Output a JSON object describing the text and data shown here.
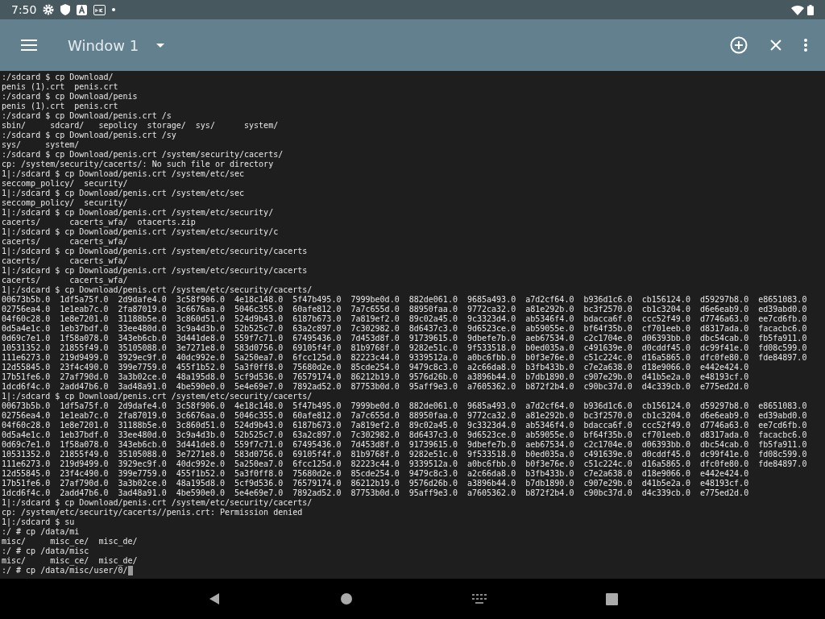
{
  "status_bar": {
    "time": "7:50"
  },
  "toolbar": {
    "title": "Window 1"
  },
  "terminal": {
    "cursor": true,
    "lines": [
      ":/sdcard $ cp Download/",
      "penis (1).crt  penis.crt",
      ":/sdcard $ cp Download/penis",
      "penis (1).crt  penis.crt",
      ":/sdcard $ cp Download/penis.crt /s",
      "sbin/     sdcard/   sepolicy  storage/  sys/      system/",
      ":/sdcard $ cp Download/penis.crt /sy",
      "sys/     system/",
      ":/sdcard $ cp Download/penis.crt /system/security/cacerts/",
      "cp: /system/security/cacerts/: No such file or directory",
      "1|:/sdcard $ cp Download/penis.crt /system/etc/sec",
      "seccomp_policy/  security/",
      "1|:/sdcard $ cp Download/penis.crt /system/etc/sec",
      "seccomp_policy/  security/",
      "1|:/sdcard $ cp Download/penis.crt /system/etc/security/",
      "cacerts/      cacerts_wfa/  otacerts.zip",
      "1|:/sdcard $ cp Download/penis.crt /system/etc/security/c",
      "cacerts/      cacerts_wfa/",
      "1|:/sdcard $ cp Download/penis.crt /system/etc/security/cacerts",
      "cacerts/      cacerts_wfa/",
      "1|:/sdcard $ cp Download/penis.crt /system/etc/security/cacerts",
      "cacerts/      cacerts_wfa/",
      "1|:/sdcard $ cp Download/penis.crt /system/etc/security/cacerts/",
      "00673b5b.0  1df5a75f.0  2d9dafe4.0  3c58f906.0  4e18c148.0  5f47b495.0  7999be0d.0  882de061.0  9685a493.0  a7d2cf64.0  b936d1c6.0  cb156124.0  d59297b8.0  e8651083.0",
      "02756ea4.0  1e1eab7c.0  2fa87019.0  3c6676aa.0  5046c355.0  60afe812.0  7a7c655d.0  88950faa.0  9772ca32.0  a81e292b.0  bc3f2570.0  cb1c3204.0  d6e6eab9.0  ed39abd0.0",
      "04f60c28.0  1e8e7201.0  31188b5e.0  3c860d51.0  524d9b43.0  6187b673.0  7a819ef2.0  89c02a45.0  9c3323d4.0  ab5346f4.0  bdacca6f.0  ccc52f49.0  d7746a63.0  ee7cd6fb.0",
      "0d5a4e1c.0  1eb37bdf.0  33ee480d.0  3c9a4d3b.0  52b525c7.0  63a2c897.0  7c302982.0  8d6437c3.0  9d6523ce.0  ab59055e.0  bf64f35b.0  cf701eeb.0  d8317ada.0  facacbc6.0",
      "0d69c7e1.0  1f58a078.0  343eb6cb.0  3d441de8.0  559f7c71.0  67495436.0  7d453d8f.0  91739615.0  9dbefe7b.0  aeb67534.0  c2c1704e.0  d06393bb.0  dbc54cab.0  fb5fa911.0",
      "10531352.0  21855f49.0  35105088.0  3e7271e8.0  583d0756.0  69105f4f.0  81b9768f.0  9282e51c.0  9f533518.0  b0ed035a.0  c491639e.0  d0cddf45.0  dc99f41e.0  fd08c599.0",
      "111e6273.0  219d9499.0  3929ec9f.0  40dc992e.0  5a250ea7.0  6fcc125d.0  82223c44.0  9339512a.0  a0bc6fbb.0  b0f3e76e.0  c51c224c.0  d16a5865.0  dfc0fe80.0  fde84897.0",
      "12d55845.0  23f4c490.0  399e7759.0  455f1b52.0  5a3f0ff8.0  75680d2e.0  85cde254.0  9479c8c3.0  a2c66da8.0  b3fb433b.0  c7e2a638.0  d18e9066.0  e442e424.0",
      "17b51fe6.0  27af790d.0  3a3b02ce.0  48a195d8.0  5cf9d536.0  76579174.0  86212b19.0  9576d26b.0  a3896b44.0  b7db1890.0  c907e29b.0  d41b5e2a.0  e48193cf.0",
      "1dcd6f4c.0  2add47b6.0  3ad48a91.0  4be590e0.0  5e4e69e7.0  7892ad52.0  87753b0d.0  95aff9e3.0  a7605362.0  b872f2b4.0  c90bc37d.0  d4c339cb.0  e775ed2d.0",
      "1|:/sdcard $ cp Download/penis.crt /system/etc/security/cacerts/",
      "00673b5b.0  1df5a75f.0  2d9dafe4.0  3c58f906.0  4e18c148.0  5f47b495.0  7999be0d.0  882de061.0  9685a493.0  a7d2cf64.0  b936d1c6.0  cb156124.0  d59297b8.0  e8651083.0",
      "02756ea4.0  1e1eab7c.0  2fa87019.0  3c6676aa.0  5046c355.0  60afe812.0  7a7c655d.0  88950faa.0  9772ca32.0  a81e292b.0  bc3f2570.0  cb1c3204.0  d6e6eab9.0  ed39abd0.0",
      "04f60c28.0  1e8e7201.0  31188b5e.0  3c860d51.0  524d9b43.0  6187b673.0  7a819ef2.0  89c02a45.0  9c3323d4.0  ab5346f4.0  bdacca6f.0  ccc52f49.0  d7746a63.0  ee7cd6fb.0",
      "0d5a4e1c.0  1eb37bdf.0  33ee480d.0  3c9a4d3b.0  52b525c7.0  63a2c897.0  7c302982.0  8d6437c3.0  9d6523ce.0  ab59055e.0  bf64f35b.0  cf701eeb.0  d8317ada.0  facacbc6.0",
      "0d69c7e1.0  1f58a078.0  343eb6cb.0  3d441de8.0  559f7c71.0  67495436.0  7d453d8f.0  91739615.0  9dbefe7b.0  aeb67534.0  c2c1704e.0  d06393bb.0  dbc54cab.0  fb5fa911.0",
      "10531352.0  21855f49.0  35105088.0  3e7271e8.0  583d0756.0  69105f4f.0  81b9768f.0  9282e51c.0  9f533518.0  b0ed035a.0  c491639e.0  d0cddf45.0  dc99f41e.0  fd08c599.0",
      "111e6273.0  219d9499.0  3929ec9f.0  40dc992e.0  5a250ea7.0  6fcc125d.0  82223c44.0  9339512a.0  a0bc6fbb.0  b0f3e76e.0  c51c224c.0  d16a5865.0  dfc0fe80.0  fde84897.0",
      "12d55845.0  23f4c490.0  399e7759.0  455f1b52.0  5a3f0ff8.0  75680d2e.0  85cde254.0  9479c8c3.0  a2c66da8.0  b3fb433b.0  c7e2a638.0  d18e9066.0  e442e424.0",
      "17b51fe6.0  27af790d.0  3a3b02ce.0  48a195d8.0  5cf9d536.0  76579174.0  86212b19.0  9576d26b.0  a3896b44.0  b7db1890.0  c907e29b.0  d41b5e2a.0  e48193cf.0",
      "1dcd6f4c.0  2add47b6.0  3ad48a91.0  4be590e0.0  5e4e69e7.0  7892ad52.0  87753b0d.0  95aff9e3.0  a7605362.0  b872f2b4.0  c90bc37d.0  d4c339cb.0  e775ed2d.0",
      "1|:/sdcard $ cp Download/penis.crt /system/etc/security/cacerts/",
      "cp: /system/etc/security/cacerts//penis.crt: Permission denied",
      "1|:/sdcard $ su",
      ":/ # cp /data/mi",
      "misc/     misc_ce/  misc_de/",
      ":/ # cp /data/misc",
      "misc/     misc_ce/  misc_de/",
      ":/ # cp /data/misc/user/0/"
    ]
  }
}
